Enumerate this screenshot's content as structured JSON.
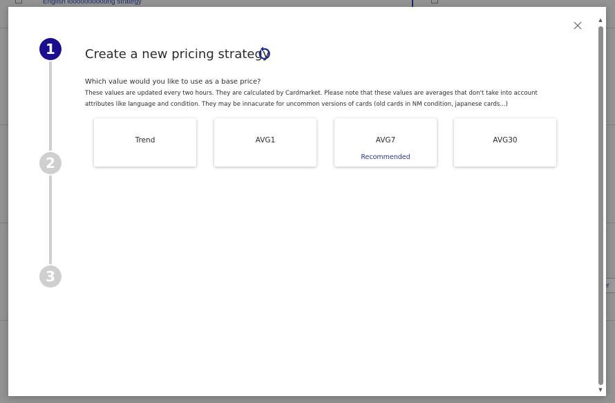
{
  "background": {
    "top_row_text": "English loooooooooong strategy"
  },
  "modal": {
    "title": "Create a new pricing strategy",
    "question": "Which value would you like to use as a base price?",
    "note": "These values are updated every two hours. They are calculated by Cardmarket. Please note that these values are averages that don't take into account attributes like language and condition. They may be innacurate for uncommon versions of cards (old cards in NM condition, japanese cards...)",
    "steps": [
      "1",
      "2",
      "3"
    ],
    "options": [
      {
        "label": "Trend",
        "sub": ""
      },
      {
        "label": "AVG1",
        "sub": ""
      },
      {
        "label": "AVG7",
        "sub": "Recommended"
      },
      {
        "label": "AVG30",
        "sub": ""
      }
    ],
    "icons": {
      "close": "close-icon",
      "reset": "reset-icon"
    }
  },
  "colors": {
    "accent": "#1b0f8e",
    "inactive_step": "#cfcfcf",
    "recommended": "#2a3580"
  }
}
